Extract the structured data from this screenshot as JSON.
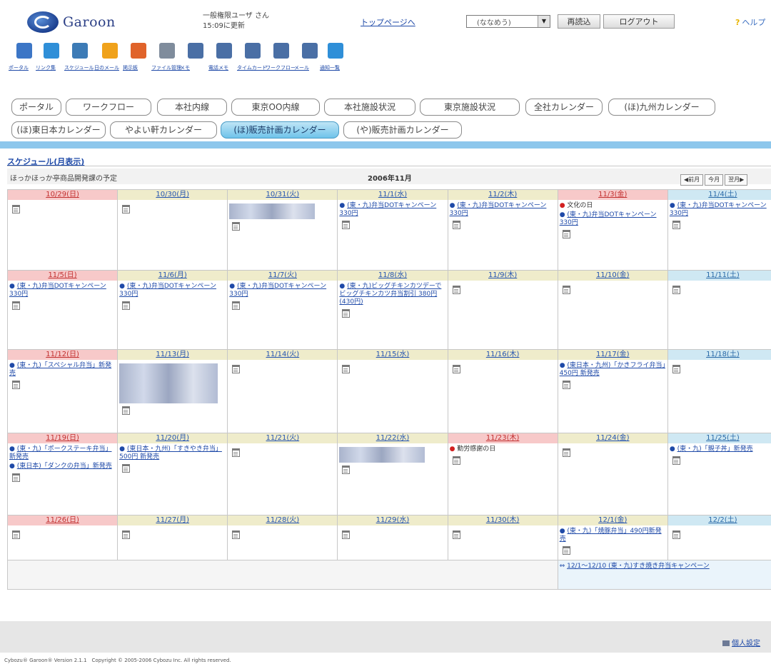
{
  "header": {
    "logo": "Garoon",
    "user_line1": "一般権限ユーザ さん",
    "user_line2": "15:09に更新",
    "top_link": "トップページへ",
    "app_select": "(ななめう)",
    "reload_button": "再読込",
    "logout_button": "ログアウト",
    "help_link": "ヘルプ"
  },
  "toolbar": [
    {
      "icon": "portal-icon",
      "label": "ポータル",
      "color": "#3c76c6"
    },
    {
      "icon": "globe-icon",
      "label": "リンク集",
      "color": "#2f8fd8"
    },
    {
      "icon": "schedule-icon",
      "label": "スケジュール",
      "color": "#3d7bb6"
    },
    {
      "icon": "memo-icon",
      "label": "日のメール",
      "color": "#f0a21b"
    },
    {
      "icon": "bulletin-icon",
      "label": "掲示板",
      "color": "#e0632a"
    },
    {
      "icon": "file-icon",
      "label": "ファイル管理",
      "color": "#7f8c9c"
    },
    {
      "icon": "memo-note-icon",
      "label": "メモ",
      "color": "#4a6fa5"
    },
    {
      "icon": "phone-memo-icon",
      "label": "電話メモ",
      "color": "#4a6fa5"
    },
    {
      "icon": "timecard-icon",
      "label": "タイムカード",
      "color": "#4a6fa5"
    },
    {
      "icon": "workflow-icon",
      "label": "ワークフロー",
      "color": "#4a6fa5"
    },
    {
      "icon": "mail-icon",
      "label": "メール",
      "color": "#4a6fa5"
    },
    {
      "icon": "notice-icon",
      "label": "通知一覧",
      "color": "#2f8fd8"
    }
  ],
  "tabs_row1": [
    "ポータル",
    "ワークフロー",
    "本社内線",
    "東京OO内線",
    "本社施設状況",
    "東京施設状況",
    "全社カレンダー",
    "(ほ)九州カレンダー"
  ],
  "tabs_row2": [
    "(ほ)東日本カレンダー",
    "やよい軒カレンダー",
    "(ほ)販売計画カレンダー",
    "(や)販売計画カレンダー"
  ],
  "schedule": {
    "title": "スケジュール(月表示)",
    "description": "ほっかほっか亭商品開発課の予定",
    "month": "2006年11月",
    "nav_prev": "◀前月",
    "nav_this": "今月",
    "nav_next": "翌月▶"
  },
  "weeks": [
    [
      {
        "date": "10/29(日)",
        "type": "sun",
        "events": []
      },
      {
        "date": "10/30(月)",
        "type": "wk",
        "events": []
      },
      {
        "date": "10/31(火)",
        "type": "wk",
        "events": [],
        "blurred": true
      },
      {
        "date": "11/1(水)",
        "type": "wk",
        "events": [
          "(東・九)弁当DOTキャンペーン 330円"
        ]
      },
      {
        "date": "11/2(木)",
        "type": "wk",
        "events": [
          "(東・九)弁当DOTキャンペーン 330円"
        ]
      },
      {
        "date": "11/3(金)",
        "type": "hol",
        "events": [
          {
            "text": "文化の日",
            "holiday": true
          },
          "(東・九)弁当DOTキャンペーン 330円"
        ]
      },
      {
        "date": "11/4(土)",
        "type": "sat",
        "events": [
          "(東・九)弁当DOTキャンペーン 330円"
        ]
      }
    ],
    [
      {
        "date": "11/5(日)",
        "type": "sun",
        "events": [
          "(東・九)弁当DOTキャンペーン 330円"
        ]
      },
      {
        "date": "11/6(月)",
        "type": "wk",
        "events": [
          "(東・九)弁当DOTキャンペーン 330円"
        ]
      },
      {
        "date": "11/7(火)",
        "type": "wk",
        "events": [
          "(東・九)弁当DOTキャンペーン 330円"
        ]
      },
      {
        "date": "11/8(水)",
        "type": "wk",
        "events": [
          "(東・九)ビッグチキンカツデーでビッグチキンカツ弁当割引 380円(430円)"
        ]
      },
      {
        "date": "11/9(木)",
        "type": "wk",
        "events": []
      },
      {
        "date": "11/10(金)",
        "type": "wk",
        "events": []
      },
      {
        "date": "11/11(土)",
        "type": "sat",
        "events": []
      }
    ],
    [
      {
        "date": "11/12(日)",
        "type": "sun",
        "events": [
          "(東・九)「スペシャル弁当」新発売"
        ]
      },
      {
        "date": "11/13(月)",
        "type": "wk",
        "events": [],
        "blurred": true
      },
      {
        "date": "11/14(火)",
        "type": "wk",
        "events": []
      },
      {
        "date": "11/15(水)",
        "type": "wk",
        "events": []
      },
      {
        "date": "11/16(木)",
        "type": "wk",
        "events": []
      },
      {
        "date": "11/17(金)",
        "type": "wk",
        "events": [
          "(東日本・九州)「かきフライ弁当」450円 新発売"
        ]
      },
      {
        "date": "11/18(土)",
        "type": "sat",
        "events": []
      }
    ],
    [
      {
        "date": "11/19(日)",
        "type": "sun",
        "events": [
          "(東・九)「ポークステーキ弁当」新発売",
          "(東日本)「ダンクの弁当」新発売"
        ]
      },
      {
        "date": "11/20(月)",
        "type": "wk",
        "events": [
          "(東日本・九州)「すきやき弁当」500円 新発売"
        ]
      },
      {
        "date": "11/21(火)",
        "type": "wk",
        "events": []
      },
      {
        "date": "11/22(水)",
        "type": "wk",
        "events": [],
        "blurred": true
      },
      {
        "date": "11/23(木)",
        "type": "hol",
        "events": [
          {
            "text": "勤労感謝の日",
            "holiday": true
          }
        ]
      },
      {
        "date": "11/24(金)",
        "type": "wk",
        "events": []
      },
      {
        "date": "11/25(土)",
        "type": "sat",
        "events": [
          "(東・九)「親子丼」新発売"
        ]
      }
    ],
    [
      {
        "date": "11/26(日)",
        "type": "sun",
        "events": []
      },
      {
        "date": "11/27(月)",
        "type": "wk",
        "events": []
      },
      {
        "date": "11/28(火)",
        "type": "wk",
        "events": []
      },
      {
        "date": "11/29(水)",
        "type": "wk",
        "events": []
      },
      {
        "date": "11/30(木)",
        "type": "wk",
        "events": []
      },
      {
        "date": "12/1(金)",
        "type": "wk",
        "events": [
          "(東・九)「焼豚弁当」490円新発売"
        ]
      },
      {
        "date": "12/2(土)",
        "type": "sat",
        "events": []
      }
    ]
  ],
  "footer_event": "12/1〜12/10 (東・九)すき焼き弁当キャンペーン",
  "bottom": {
    "personal_settings": "個人設定",
    "copyright": "Cybozu® Garoon® Version 2.1.1　Copyright © 2005-2006 Cybozu Inc. All rights reserved."
  },
  "colors": {
    "link": "#1f4aa8",
    "sunday_header": "#f7c9c9",
    "saturday_header": "#cfe8f3",
    "weekday_header": "#efeccb",
    "active_tab": "#6fc3ea"
  }
}
